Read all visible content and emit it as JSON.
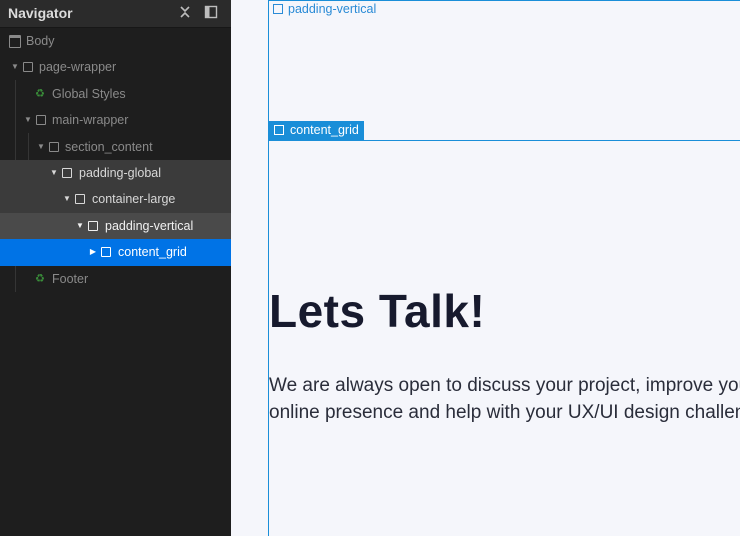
{
  "navigator": {
    "title": "Navigator"
  },
  "tree": {
    "items": [
      {
        "label": "Body"
      },
      {
        "label": "page-wrapper"
      },
      {
        "label": "Global Styles"
      },
      {
        "label": "main-wrapper"
      },
      {
        "label": "section_content"
      },
      {
        "label": "padding-global"
      },
      {
        "label": "container-large"
      },
      {
        "label": "padding-vertical"
      },
      {
        "label": "content_grid"
      },
      {
        "label": "Footer"
      }
    ]
  },
  "canvas": {
    "padding_vertical_tag": "padding-vertical",
    "content_grid_tag": "content_grid",
    "heading": "Lets Talk!",
    "paragraph": "We are always open to discuss your project, improve your online presence and help with your UX/UI design challenges."
  },
  "colors": {
    "selection": "#0073e6",
    "outline": "#1a8ed8",
    "component_icon": "#3a8f3a"
  },
  "icons": {
    "collapse": "collapse-icon",
    "dock": "dock-panel-icon",
    "element": "element-box-icon",
    "component": "component-icon",
    "body": "body-icon"
  }
}
